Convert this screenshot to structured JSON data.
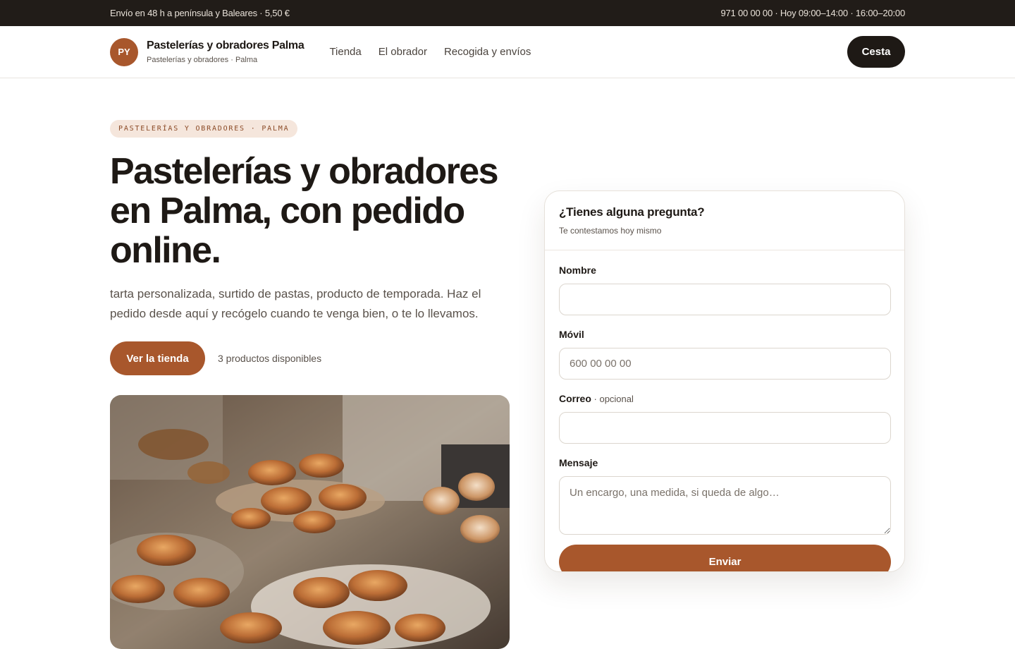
{
  "topbar": {
    "shipping": "Envío en 48 h a península y Baleares · 5,50 €",
    "contact": "971 00 00 00 · Hoy 09:00–14:00 · 16:00–20:00"
  },
  "header": {
    "logo_initials": "PY",
    "brand_name": "Pastelerías y obradores Palma",
    "brand_sub": "Pastelerías y obradores · Palma",
    "nav": [
      "Tienda",
      "El obrador",
      "Recogida y envíos"
    ],
    "cart_label": "Cesta"
  },
  "hero": {
    "eyebrow": "PASTELERÍAS Y OBRADORES · PALMA",
    "headline": "Pastelerías y obradores en Palma, con pedido online.",
    "lead": "tarta personalizada, surtido de pastas, producto de temporada. Haz el pedido desde aquí y recógelo cuando te venga bien, o te lo llevamos.",
    "cta_label": "Ver la tienda",
    "stock_note": "3 productos disponibles"
  },
  "form": {
    "title": "¿Tienes alguna pregunta?",
    "subtitle": "Te contestamos hoy mismo",
    "name_label": "Nombre",
    "name_placeholder": "",
    "phone_label": "Móvil",
    "phone_placeholder": "600 00 00 00",
    "email_label": "Correo",
    "email_optional": " · opcional",
    "email_placeholder": "",
    "message_label": "Mensaje",
    "message_placeholder": "Un encargo, una medida, si queda de algo…",
    "submit_label": "Enviar"
  },
  "colors": {
    "accent": "#a8572c",
    "dark": "#1e1915",
    "topbar_bg": "#211c18",
    "eyebrow_bg": "#f5e6dc"
  }
}
